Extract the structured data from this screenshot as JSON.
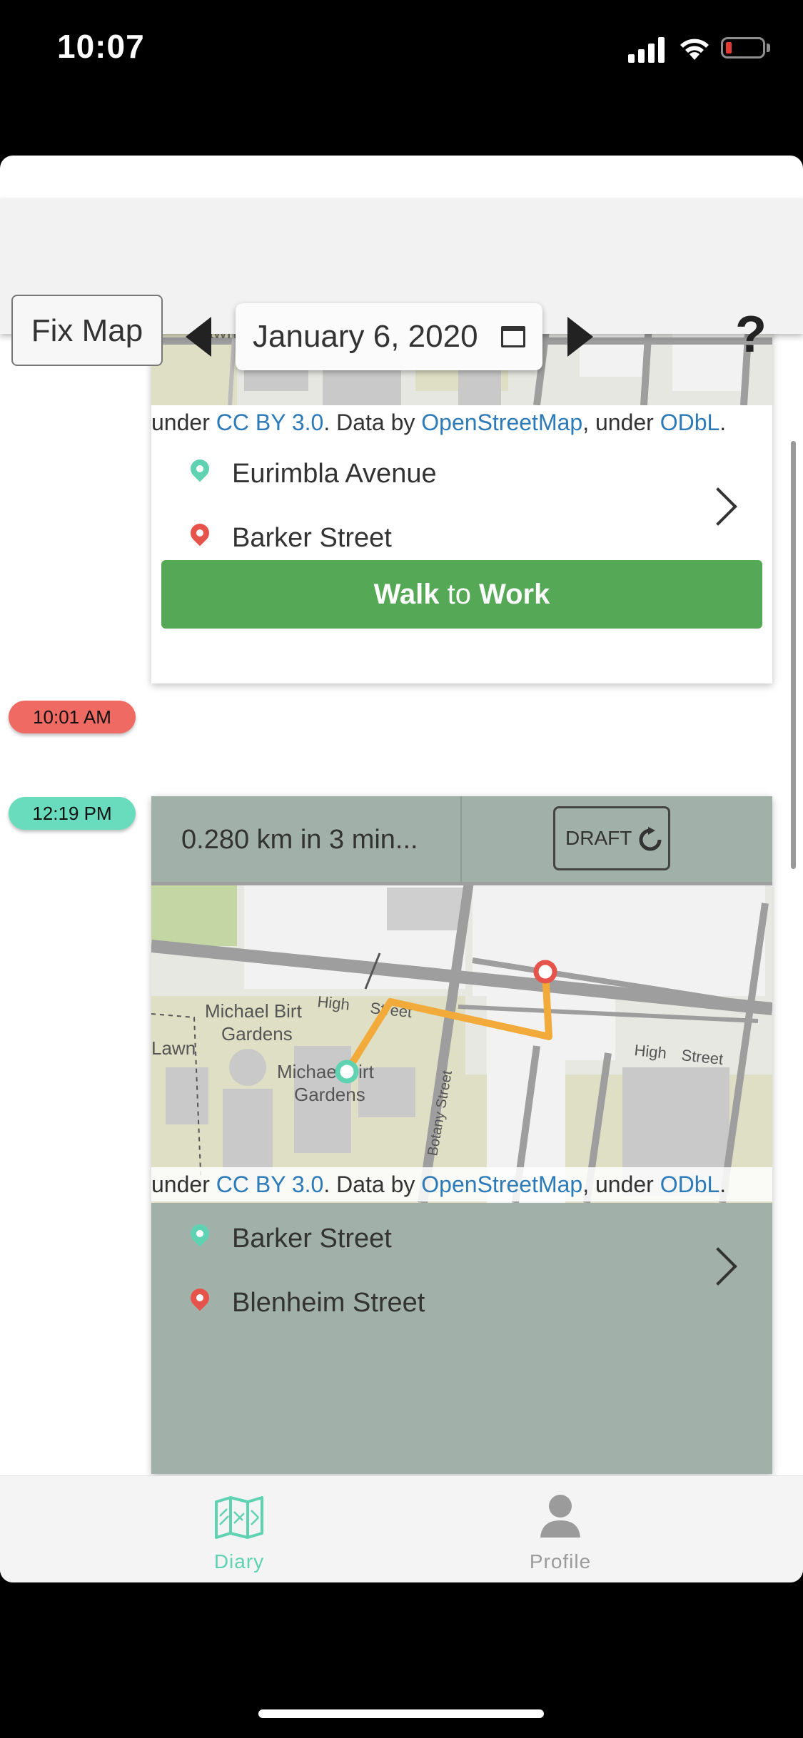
{
  "status": {
    "time": "10:07"
  },
  "header": {
    "fix_map_label": "Fix Map",
    "date": "January 6, 2020",
    "help_label": "?"
  },
  "trips": [
    {
      "origin": "Eurimbla Avenue",
      "destination": "Barker Street",
      "attribution": {
        "prefix": "under ",
        "cc": "CC BY 3.0",
        "mid": ". Data by ",
        "osm": "OpenStreetMap",
        "mid2": ", under ",
        "odbl": "ODbL",
        "end": "."
      },
      "map_label_lawn": "Lawn",
      "purpose_mode": "Walk",
      "purpose_to": "to",
      "purpose_dest": "Work"
    },
    {
      "start_time": "12:19 PM",
      "summary": "0.280 km in 3 min...",
      "draft_label": "DRAFT",
      "origin": "Barker Street",
      "destination": "Blenheim Street",
      "attribution": {
        "prefix": "under ",
        "cc": "CC BY 3.0",
        "mid": ". Data by ",
        "osm": "OpenStreetMap",
        "mid2": ", under ",
        "odbl": "ODbL",
        "end": "."
      },
      "map_labels": {
        "gardens_name": "Michael Birt",
        "gardens_word": "Gardens",
        "gardens_name2": "Michael Birt",
        "gardens_word2": "Gardens",
        "lawn": "Lawn",
        "street_high1": "High",
        "street_high2": "Street",
        "street_high3": "High",
        "street_high4": "Street",
        "street_botany": "Botany Street"
      }
    }
  ],
  "time_pill_end": "10:01 AM",
  "tabs": [
    {
      "label": "Diary",
      "active": true
    },
    {
      "label": "Profile",
      "active": false
    }
  ],
  "colors": {
    "accent": "#5fd2b2",
    "walk_button": "#55a855",
    "end_pill": "#ee6a62",
    "start_pill": "#68dcbd",
    "draft_card": "#a1b0a8",
    "route": "#f2ab3a"
  }
}
